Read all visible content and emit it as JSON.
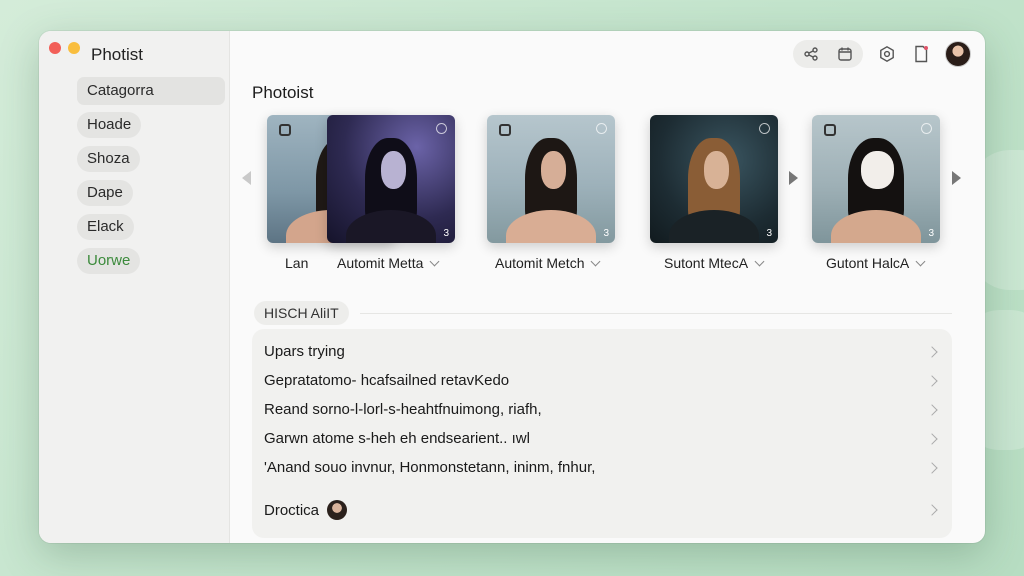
{
  "window": {
    "app_title": "Photist"
  },
  "sidebar": {
    "items": [
      {
        "label": "Catagorra",
        "selected": true
      },
      {
        "label": "Hoade"
      },
      {
        "label": "Shoza"
      },
      {
        "label": "Dape"
      },
      {
        "label": "Elack"
      },
      {
        "label": "Uorwe",
        "accent": true
      }
    ]
  },
  "toolbar": {
    "icons": [
      "share-icon",
      "calendar-icon",
      "settings-icon",
      "document-icon",
      "avatar"
    ]
  },
  "main": {
    "section_title": "Photoist",
    "gallery": [
      {
        "label": "Lan",
        "has_menu": false
      },
      {
        "label": "Automit Metta",
        "has_menu": true
      },
      {
        "label": "Automit Metch",
        "has_menu": true
      },
      {
        "label": "Sutont MtecA",
        "has_menu": true
      },
      {
        "label": "Gutont HalcA",
        "has_menu": true
      }
    ],
    "group_label": "HISCH AliIT",
    "rows": [
      {
        "text": "Upars trying"
      },
      {
        "text": "Gepratatomo- hcafsailned retavKedo"
      },
      {
        "text": "Reand sorno-l-lorl-s-heahtfnuimong, riafh,"
      },
      {
        "text": "Garwn atome s-heh eh endsearient.. ıwl"
      },
      {
        "text": "'Anand souo  invnur,  Honmonstetann,  ininm,  fnhur,"
      },
      {
        "text": "Droctica"
      }
    ]
  },
  "colors": {
    "background": "#c3e4cc",
    "accent_green": "#3b8a3b",
    "close": "#f25f58",
    "minimize": "#f9be3e"
  }
}
